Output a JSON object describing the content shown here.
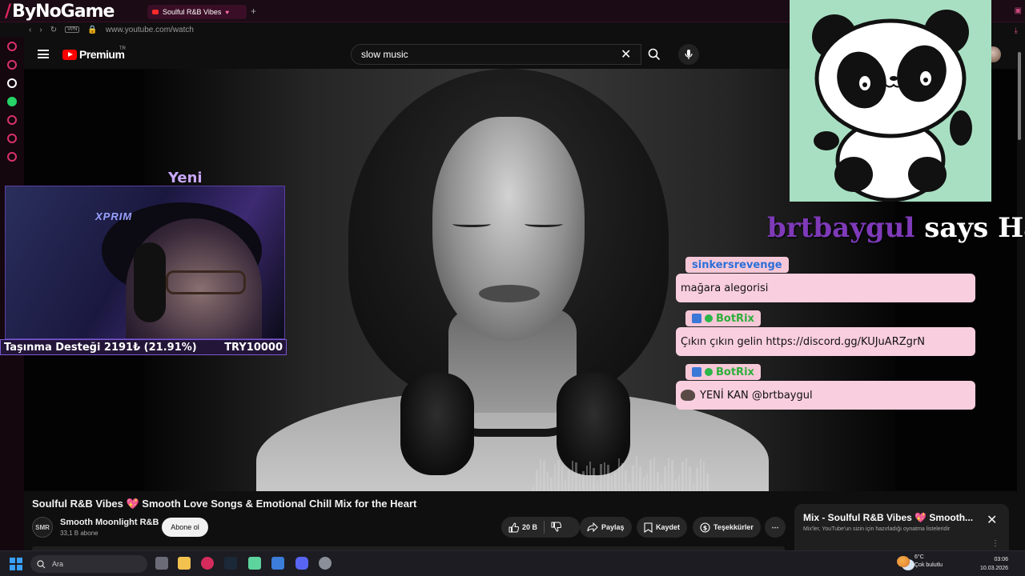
{
  "browser": {
    "brand": "ByNoGame",
    "tab_title": "Soulful R&B Vibes",
    "url": "www.youtube.com/watch",
    "vpn_label": "VPN"
  },
  "youtube": {
    "logo_text": "Premium",
    "country": "TR",
    "search_value": "slow music"
  },
  "stream": {
    "new_label": "Yeni",
    "webcam_logo": "XPRIM",
    "donation_label": "Taşınma Desteği 2191₺ (21.91%)",
    "donation_goal": "TRY10000",
    "greet_user": "brtbaygul",
    "greet_text": " says Hai!",
    "chat": [
      {
        "name": "sinkersrevenge",
        "message": "mağara alegorisi"
      },
      {
        "name": "BotRix",
        "message": "Çıkın çıkın gelin https://discord.gg/KUJuARZgrN"
      },
      {
        "name": "BotRix",
        "message": "YENİ KAN @brtbaygul"
      }
    ]
  },
  "video": {
    "title": "Soulful R&B Vibes 💖 Smooth Love Songs & Emotional Chill Mix for the Heart",
    "channel_initials": "SMR",
    "channel_name": "Smooth Moonlight R&B",
    "subscribers": "33,1 B abone",
    "subscribe_label": "Abone ol",
    "like_count": "20 B",
    "share_label": "Paylaş",
    "save_label": "Kaydet",
    "thanks_label": "Teşekkürler"
  },
  "mix": {
    "title": "Mix - Soulful R&B Vibes 💖 Smooth...",
    "subtitle": "Mix'ler, YouTube'un sizin için hazırladığı oynatma listeleridir"
  },
  "taskbar": {
    "search_placeholder": "Ara",
    "temperature": "6°C",
    "weather": "Çok bulutlu",
    "time": "03:06",
    "date": "10.03.2026"
  },
  "colors": {
    "accent": "#e0245e",
    "youtube_red": "#ff0000",
    "chat_bg": "#f9cede",
    "greet_user": "#7e3ab8"
  }
}
